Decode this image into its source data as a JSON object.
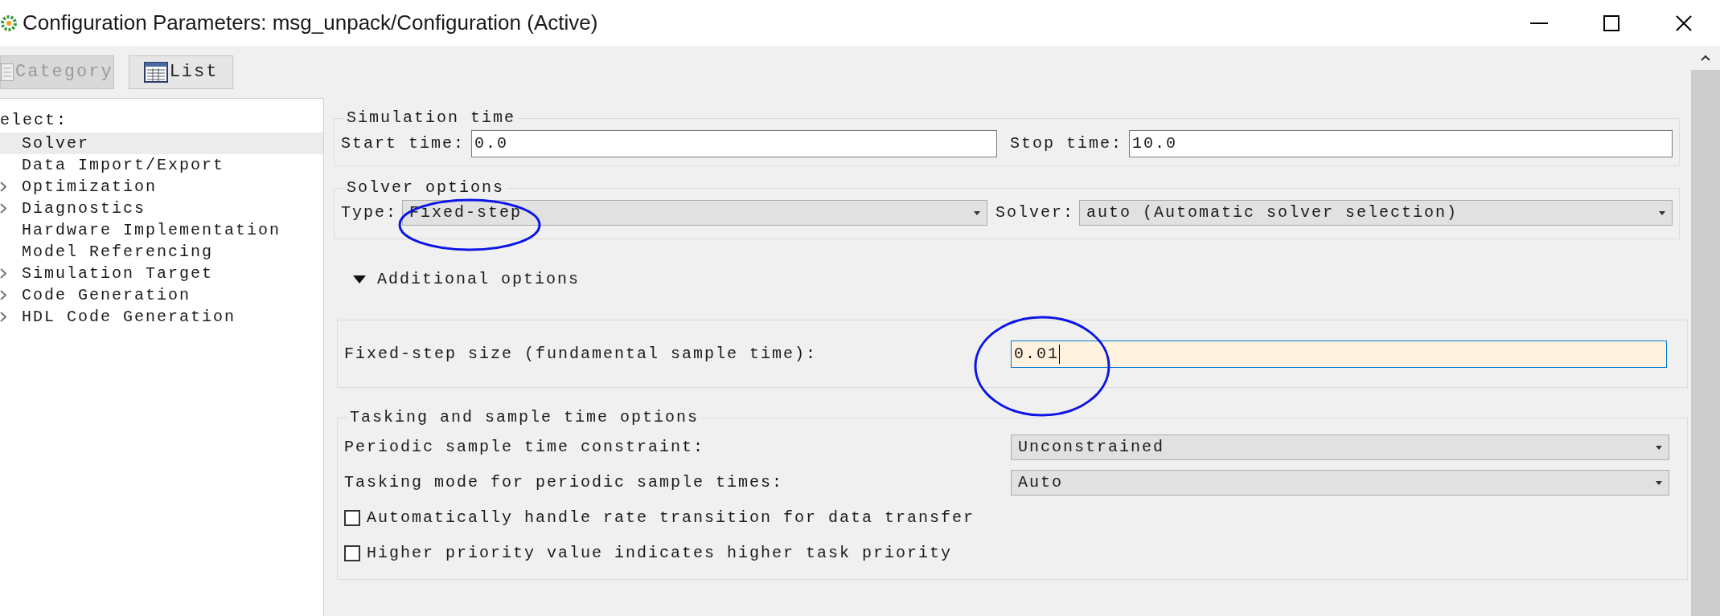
{
  "window": {
    "title": "Configuration Parameters: msg_unpack/Configuration (Active)"
  },
  "toolbar": [
    {
      "kind": "category",
      "label": "Category",
      "disabled": true
    },
    {
      "kind": "list",
      "label": "List",
      "disabled": false
    }
  ],
  "tree": {
    "heading": "elect:",
    "items": [
      {
        "label": "Solver",
        "selected": true,
        "has_children": false
      },
      {
        "label": "Data Import/Export",
        "selected": false,
        "has_children": false
      },
      {
        "label": "Optimization",
        "selected": false,
        "has_children": true
      },
      {
        "label": "Diagnostics",
        "selected": false,
        "has_children": true
      },
      {
        "label": "Hardware Implementation",
        "selected": false,
        "has_children": false
      },
      {
        "label": "Model Referencing",
        "selected": false,
        "has_children": false
      },
      {
        "label": "Simulation Target",
        "selected": false,
        "has_children": true
      },
      {
        "label": "Code Generation",
        "selected": false,
        "has_children": true
      },
      {
        "label": "HDL Code Generation",
        "selected": false,
        "has_children": true
      }
    ]
  },
  "simulation_time": {
    "title": "Simulation time",
    "start_label": "Start time:",
    "start_value": "0.0",
    "stop_label": "Stop time:",
    "stop_value": "10.0"
  },
  "solver_options": {
    "title": "Solver options",
    "type_label": "Type:",
    "type_value": "Fixed-step",
    "solver_label": "Solver:",
    "solver_value": "auto (Automatic solver selection)"
  },
  "additional_options": {
    "label": "Additional options",
    "expanded": true
  },
  "fixed_step": {
    "label": "Fixed-step size (fundamental sample time):",
    "value": "0.01",
    "focused": true
  },
  "tasking": {
    "title": "Tasking and sample time options",
    "rows": [
      {
        "kind": "dropdown",
        "label": "Periodic sample time constraint:",
        "value": "Unconstrained"
      },
      {
        "kind": "dropdown",
        "label": "Tasking mode for periodic sample times:",
        "value": "Auto"
      },
      {
        "kind": "checkbox",
        "label": "Automatically handle rate transition for data transfer",
        "checked": false
      },
      {
        "kind": "checkbox",
        "label": "Higher priority value indicates higher task priority",
        "checked": false
      }
    ]
  }
}
